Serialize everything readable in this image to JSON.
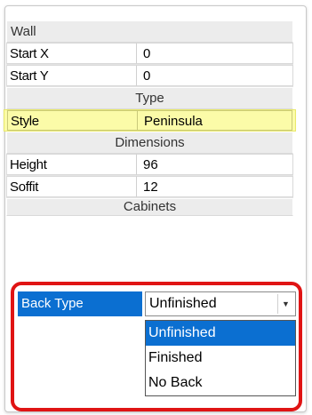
{
  "panel": {
    "header": "Wall",
    "rows_top": [
      {
        "label": "Start X",
        "value": "0"
      },
      {
        "label": "Start Y",
        "value": "0"
      }
    ],
    "section_type": "Type",
    "style_row": {
      "label": "Style",
      "value": "Peninsula"
    },
    "section_dimensions": "Dimensions",
    "rows_dims": [
      {
        "label": "Height",
        "value": "96"
      },
      {
        "label": "Soffit",
        "value": "12"
      }
    ],
    "section_cabinets": "Cabinets",
    "back_type": {
      "label": "Back Type",
      "value": "Unfinished",
      "options": [
        "Unfinished",
        "Finished",
        "No Back"
      ],
      "selected_index": 0
    }
  },
  "colors": {
    "highlight": "#fbfba8",
    "selection": "#0b6fd1",
    "annotation": "#e01414"
  }
}
